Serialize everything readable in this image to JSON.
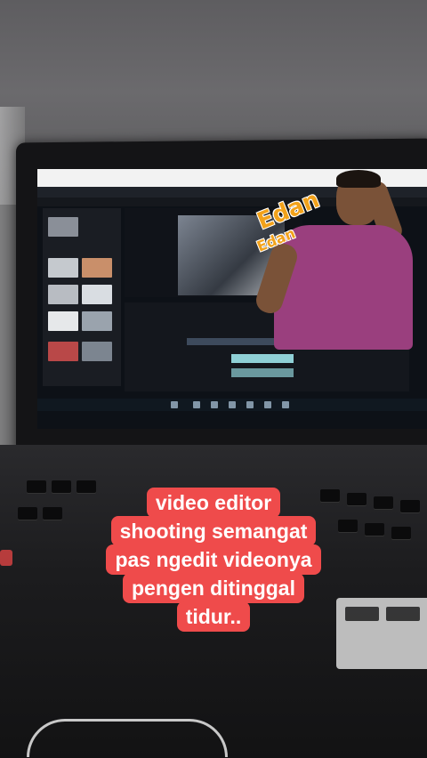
{
  "overlay": {
    "sticker_words": [
      "Edan",
      "Edan"
    ],
    "sticker_color": "#f2a21b"
  },
  "caption": {
    "lines": [
      "video editor",
      "shooting semangat",
      "pas ngedit videonya",
      "pengen ditinggal",
      "tidur.."
    ],
    "background": "#ef4b4b",
    "text_color": "#ffffff"
  }
}
